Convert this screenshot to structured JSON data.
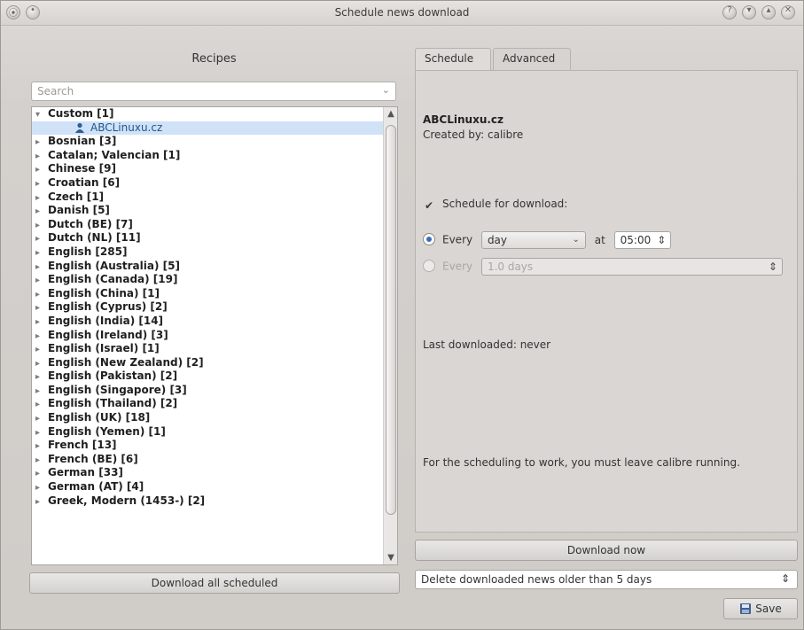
{
  "window": {
    "title": "Schedule news download"
  },
  "left": {
    "title": "Recipes",
    "search_placeholder": "Search",
    "tree": [
      {
        "label": "Custom [1]",
        "expanded": true
      },
      {
        "label": "ABCLinuxu.cz",
        "child": true,
        "selected": true
      },
      {
        "label": "Bosnian [3]"
      },
      {
        "label": "Catalan; Valencian [1]"
      },
      {
        "label": "Chinese [9]"
      },
      {
        "label": "Croatian [6]"
      },
      {
        "label": "Czech [1]"
      },
      {
        "label": "Danish [5]"
      },
      {
        "label": "Dutch (BE) [7]"
      },
      {
        "label": "Dutch (NL) [11]"
      },
      {
        "label": "English [285]"
      },
      {
        "label": "English (Australia) [5]"
      },
      {
        "label": "English (Canada) [19]"
      },
      {
        "label": "English (China) [1]"
      },
      {
        "label": "English (Cyprus) [2]"
      },
      {
        "label": "English (India) [14]"
      },
      {
        "label": "English (Ireland) [3]"
      },
      {
        "label": "English (Israel) [1]"
      },
      {
        "label": "English (New Zealand) [2]"
      },
      {
        "label": "English (Pakistan) [2]"
      },
      {
        "label": "English (Singapore) [3]"
      },
      {
        "label": "English (Thailand) [2]"
      },
      {
        "label": "English (UK) [18]"
      },
      {
        "label": "English (Yemen) [1]"
      },
      {
        "label": "French [13]"
      },
      {
        "label": "French (BE) [6]"
      },
      {
        "label": "German [33]"
      },
      {
        "label": "German (AT) [4]"
      },
      {
        "label": "Greek, Modern (1453-) [2]"
      }
    ],
    "download_all_label": "Download all scheduled"
  },
  "right": {
    "tabs": [
      {
        "label": "Schedule",
        "active": true
      },
      {
        "label": "Advanced",
        "active": false
      }
    ],
    "recipe_title": "ABCLinuxu.cz",
    "created_by": "Created by: calibre",
    "schedule_checkbox_label": "Schedule for download:",
    "schedule_checked": true,
    "every_label_1": "Every",
    "every_select_value": "day",
    "at_label": "at",
    "time_value": "05:00",
    "every_label_2": "Every",
    "interval_value": "1.0 days",
    "last_downloaded": "Last downloaded: never",
    "note": "For the scheduling to work, you must leave calibre running.",
    "download_now_label": "Download now",
    "delete_option": "Delete downloaded news older than 5 days",
    "save_label": "Save"
  },
  "colors": {
    "selection": "#cfe2f7",
    "accent": "#3c6fb2"
  }
}
